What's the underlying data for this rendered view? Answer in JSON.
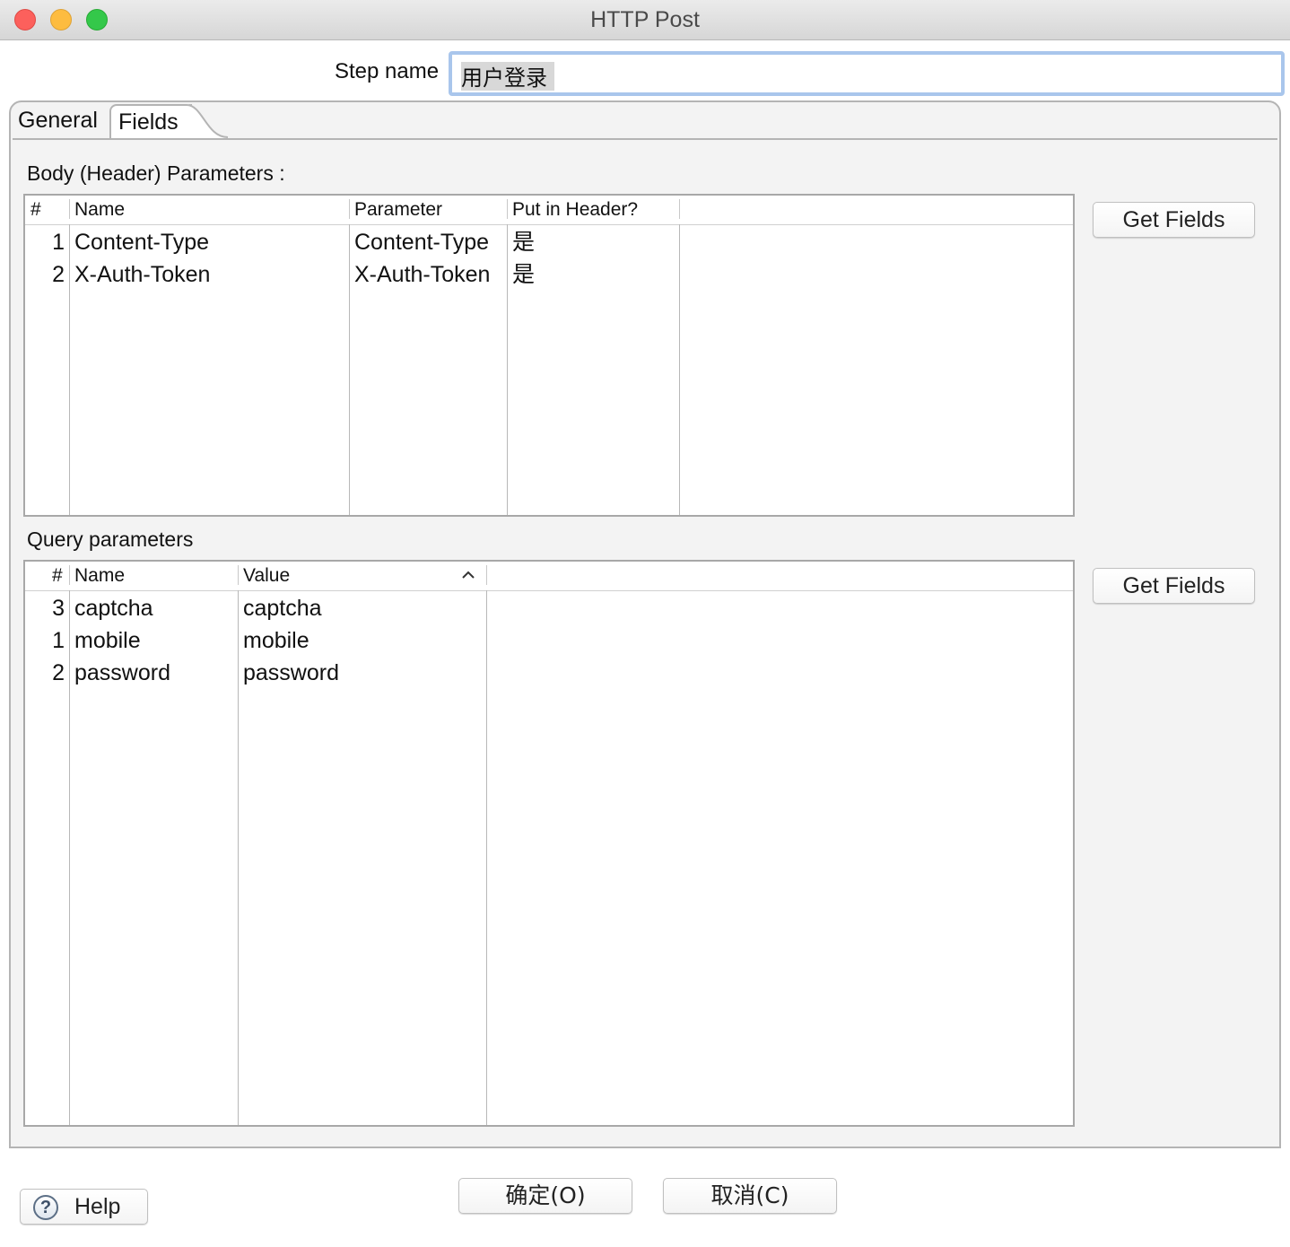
{
  "window": {
    "title": "HTTP Post"
  },
  "step_name": {
    "label": "Step name",
    "value": "用户登录"
  },
  "tabs": [
    {
      "label": "General",
      "active": false
    },
    {
      "label": "Fields",
      "active": true
    }
  ],
  "body_params": {
    "section_label": "Body (Header) Parameters :",
    "columns": [
      "#",
      "Name",
      "Parameter",
      "Put in Header?"
    ],
    "rows": [
      {
        "num": "1",
        "name": "Content-Type",
        "parameter": "Content-Type",
        "header": "是"
      },
      {
        "num": "2",
        "name": "X-Auth-Token",
        "parameter": "X-Auth-Token",
        "header": "是"
      }
    ],
    "get_fields_label": "Get Fields"
  },
  "query_params": {
    "section_label": "Query parameters",
    "columns": [
      "#",
      "Name",
      "Value"
    ],
    "sort_indicator": "sort-ascending-icon",
    "rows": [
      {
        "num": "3",
        "name": "captcha",
        "value": "captcha"
      },
      {
        "num": "1",
        "name": "mobile",
        "value": "mobile"
      },
      {
        "num": "2",
        "name": "password",
        "value": "password"
      }
    ],
    "get_fields_label": "Get Fields"
  },
  "footer": {
    "help_label": "Help",
    "help_icon": "question-mark-icon",
    "ok_label": "确定(O)",
    "cancel_label": "取消(C)"
  },
  "colors": {
    "focus_ring": "#a9c6ec",
    "close": "#fc605c",
    "minimize": "#fdbc40",
    "maximize": "#34c84a"
  }
}
